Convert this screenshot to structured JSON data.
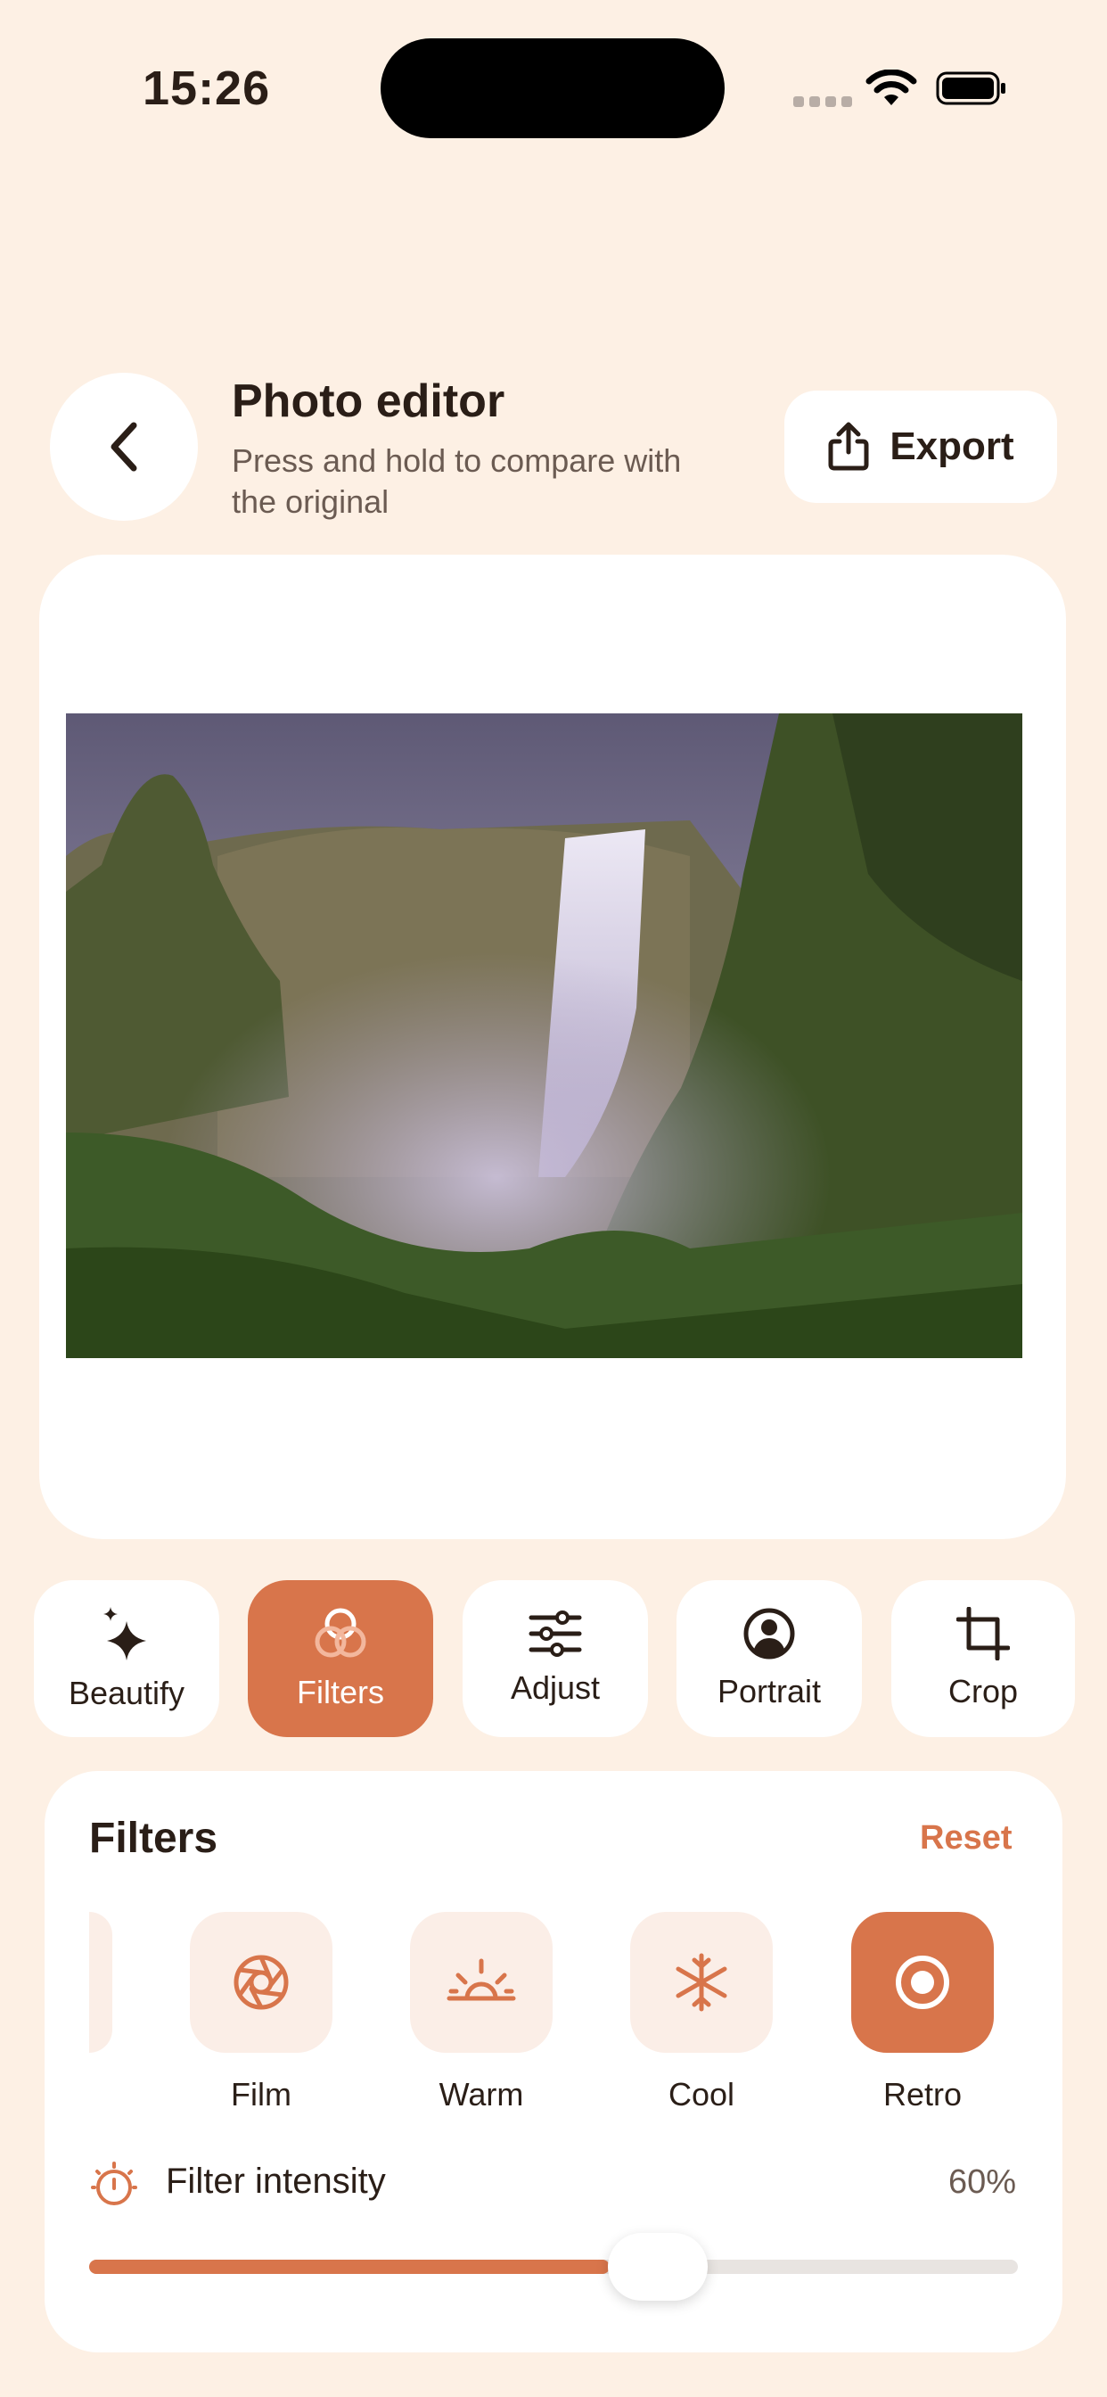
{
  "status_bar": {
    "time": "15:26"
  },
  "header": {
    "title": "Photo editor",
    "subtitle": "Press and hold to compare with the original",
    "export_label": "Export"
  },
  "tools": [
    {
      "label": "Beautify",
      "icon": "sparkles-icon"
    },
    {
      "label": "Filters",
      "icon": "filters-icon",
      "active": true
    },
    {
      "label": "Adjust",
      "icon": "sliders-icon"
    },
    {
      "label": "Portrait",
      "icon": "portrait-icon"
    },
    {
      "label": "Crop",
      "icon": "crop-icon"
    }
  ],
  "filters_panel": {
    "title": "Filters",
    "reset_label": "Reset",
    "filters": [
      {
        "label": "Film",
        "icon": "aperture-icon"
      },
      {
        "label": "Warm",
        "icon": "sunrise-icon"
      },
      {
        "label": "Cool",
        "icon": "snowflake-icon"
      },
      {
        "label": "Retro",
        "icon": "record-icon",
        "selected": true
      }
    ],
    "intensity_label": "Filter intensity",
    "intensity_value": "60%",
    "intensity_fraction": 0.6
  },
  "colors": {
    "background": "#FDF0E4",
    "accent": "#D8754B",
    "card": "#FFFFFF",
    "filter_tile": "#FBEEE7"
  }
}
